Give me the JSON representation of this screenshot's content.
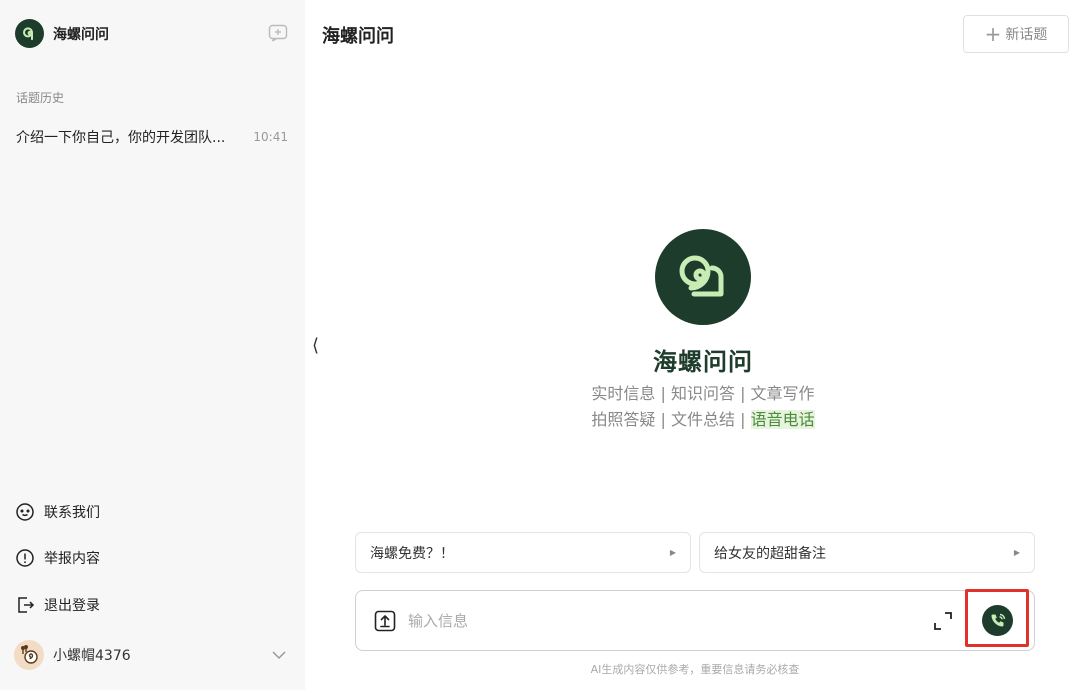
{
  "sidebar": {
    "brand_title": "海螺问问",
    "history_label": "话题历史",
    "history": [
      {
        "title": "介绍一下你自己，你的开发团队...",
        "time": "10:41"
      }
    ],
    "links": {
      "contact": "联系我们",
      "report": "举报内容",
      "logout": "退出登录"
    },
    "user": {
      "name": "小螺帽4376"
    }
  },
  "header": {
    "title": "海螺问问",
    "new_topic_label": "新话题",
    "collapse_glyph": "⟨"
  },
  "hero": {
    "title": "海螺问问",
    "features_line1": "实时信息 | 知识问答 | 文章写作",
    "features_line2_prefix": "拍照答疑 | 文件总结 | ",
    "features_line2_highlight": "语音电话"
  },
  "suggestions": [
    {
      "label": "海螺免费？！"
    },
    {
      "label": "给女友的超甜备注"
    }
  ],
  "composer": {
    "placeholder": "输入信息",
    "disclaimer": "AI生成内容仅供参考，重要信息请务必核查"
  },
  "colors": {
    "brand_dark": "#1e3c2c",
    "brand_light": "#c9ecb4",
    "highlight_bg": "#e6f4dd",
    "annotation_red": "#e0312a"
  }
}
